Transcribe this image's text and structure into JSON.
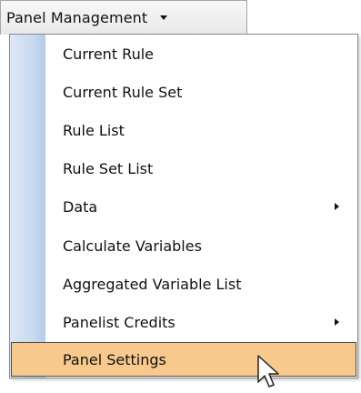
{
  "header": {
    "title": "Panel Management",
    "icon": "caret-down-icon"
  },
  "menu": {
    "items": [
      {
        "label": "Current Rule"
      },
      {
        "label": "Current Rule Set"
      },
      {
        "label": "Rule List"
      },
      {
        "label": "Rule Set List"
      },
      {
        "label": "Data",
        "submenu_icon": "submenu-arrow-icon"
      },
      {
        "label": "Calculate Variables"
      },
      {
        "label": "Aggregated Variable List"
      },
      {
        "label": "Panelist Credits",
        "submenu_icon": "submenu-arrow-icon"
      },
      {
        "label": "Panel Settings",
        "highlighted": true
      }
    ]
  },
  "colors": {
    "highlight": "#f8c98d",
    "gutter": "#c9dbf0"
  },
  "cursor": {
    "icon": "pointer-icon"
  }
}
